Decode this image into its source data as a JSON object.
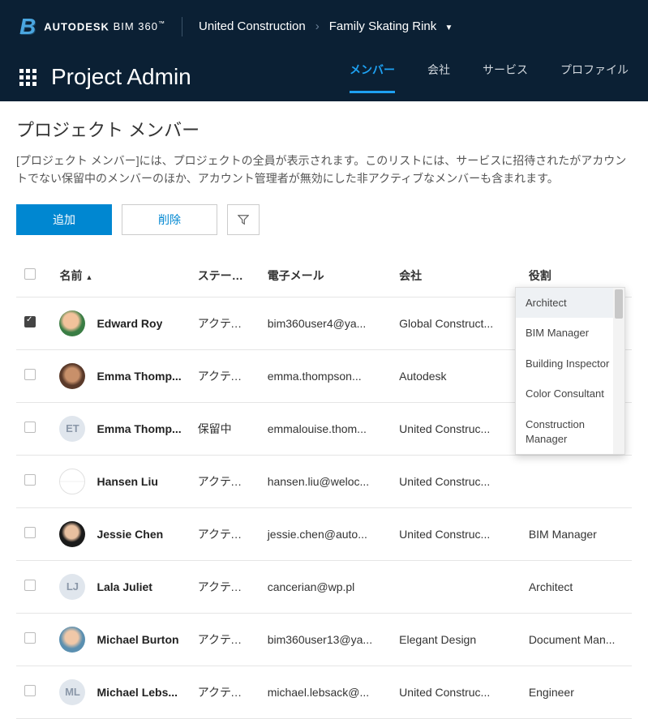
{
  "header": {
    "brand_auto": "AUTODESK",
    "brand_bim": "BIM 360",
    "tm": "™",
    "breadcrumb": [
      "United Construction",
      "Family Skating Rink"
    ]
  },
  "nav": {
    "page_title": "Project Admin",
    "tabs": [
      {
        "label": "メンバー",
        "active": true
      },
      {
        "label": "会社",
        "active": false
      },
      {
        "label": "サービス",
        "active": false
      },
      {
        "label": "プロファイル",
        "active": false
      }
    ]
  },
  "content": {
    "sub_title": "プロジェクト メンバー",
    "description": "[プロジェクト メンバー]には、プロジェクトの全員が表示されます。このリストには、サービスに招待されたがアカウントでない保留中のメンバーのほか、アカウント管理者が無効にした非アクティブなメンバーも含まれます。"
  },
  "actions": {
    "add": "追加",
    "delete": "削除"
  },
  "table": {
    "columns": {
      "name": "名前",
      "status": "ステータ...",
      "email": "電子メール",
      "company": "会社",
      "role": "役割"
    },
    "rows": [
      {
        "checked": true,
        "avatar": "img1",
        "initials": "",
        "name": "Edward Roy",
        "status": "アクティ...",
        "email": "bim360user4@ya...",
        "company": "Global Construct...",
        "role": ""
      },
      {
        "checked": false,
        "avatar": "img2",
        "initials": "",
        "name": "Emma Thomp...",
        "status": "アクティ...",
        "email": "emma.thompson...",
        "company": "Autodesk",
        "role": ""
      },
      {
        "checked": false,
        "avatar": "initials",
        "initials": "ET",
        "name": "Emma Thomp...",
        "status": "保留中",
        "email": "emmalouise.thom...",
        "company": "United Construc...",
        "role": ""
      },
      {
        "checked": false,
        "avatar": "img3",
        "initials": "",
        "name": "Hansen Liu",
        "status": "アクティ...",
        "email": "hansen.liu@weloc...",
        "company": "United Construc...",
        "role": ""
      },
      {
        "checked": false,
        "avatar": "img4",
        "initials": "",
        "name": "Jessie Chen",
        "status": "アクティ...",
        "email": "jessie.chen@auto...",
        "company": "United Construc...",
        "role": "BIM Manager"
      },
      {
        "checked": false,
        "avatar": "initials",
        "initials": "LJ",
        "name": "Lala Juliet",
        "status": "アクティ...",
        "email": "cancerian@wp.pl",
        "company": "",
        "role": "Architect"
      },
      {
        "checked": false,
        "avatar": "img5",
        "initials": "",
        "name": "Michael Burton",
        "status": "アクティ...",
        "email": "bim360user13@ya...",
        "company": "Elegant Design",
        "role": "Document Man..."
      },
      {
        "checked": false,
        "avatar": "initials",
        "initials": "ML",
        "name": "Michael Lebs...",
        "status": "アクティ...",
        "email": "michael.lebsack@...",
        "company": "United Construc...",
        "role": "Engineer"
      }
    ]
  },
  "dropdown": {
    "options": [
      "Architect",
      "BIM Manager",
      "Building Inspector",
      "Color Consultant",
      "Construction Manager"
    ]
  }
}
